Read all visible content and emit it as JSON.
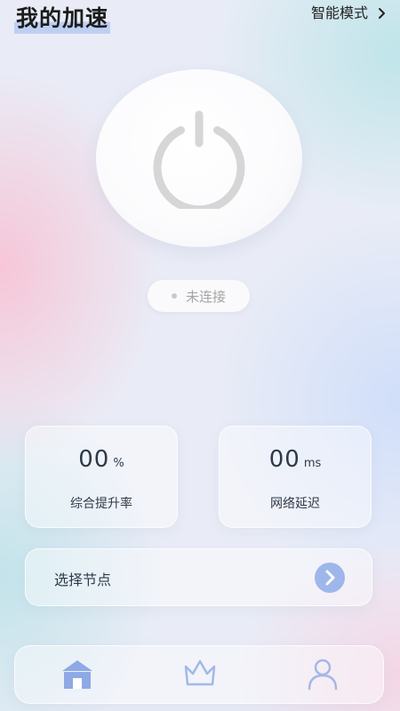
{
  "header": {
    "title": "我的加速",
    "mode_label": "智能模式",
    "mode_icon": "chevron-right-icon"
  },
  "power": {
    "icon": "power-icon"
  },
  "status": {
    "text": "未连接",
    "dot_color": "#c9c9c9"
  },
  "stats": [
    {
      "value": "00",
      "unit": "%",
      "label": "综合提升率"
    },
    {
      "value": "00",
      "unit": "ms",
      "label": "网络延迟"
    }
  ],
  "node_selector": {
    "label": "选择节点",
    "icon": "arrow-right-circle-icon",
    "accent_color": "#9eb6ea"
  },
  "tab_bar": {
    "items": [
      {
        "icon": "home-icon",
        "active": true,
        "color": "#8fa9e6"
      },
      {
        "icon": "crown-icon",
        "active": false,
        "color": "#a3b8e8"
      },
      {
        "icon": "user-icon",
        "active": false,
        "color": "#a3b8e8"
      }
    ]
  }
}
